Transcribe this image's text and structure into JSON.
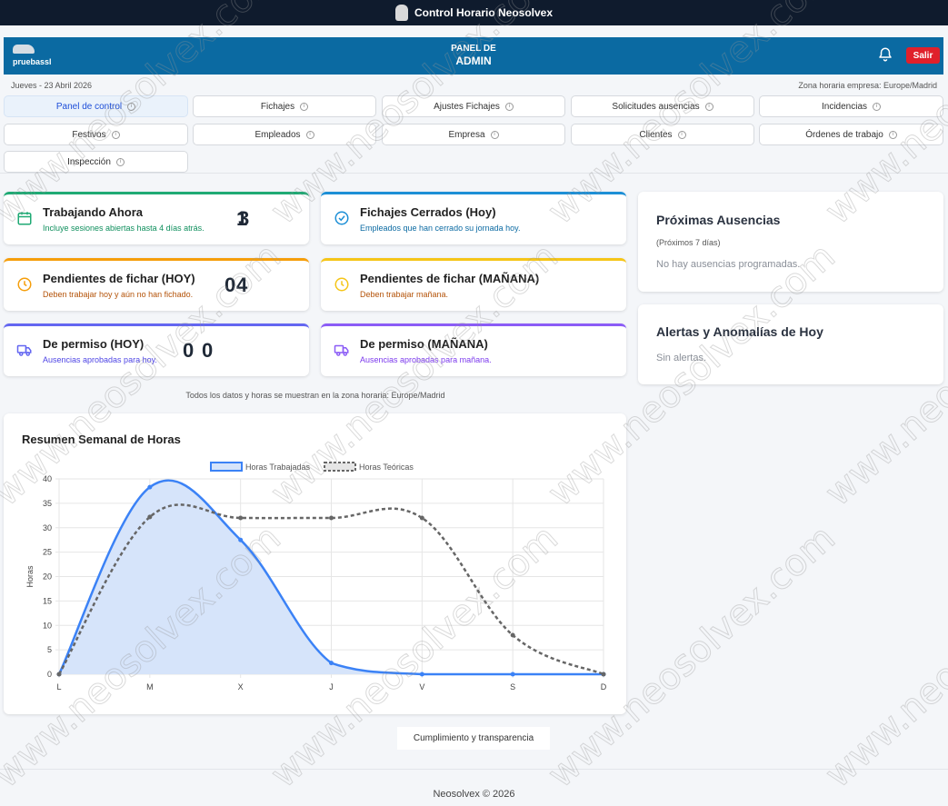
{
  "app": {
    "title": "Control Horario Neosolvex"
  },
  "header": {
    "username": "pruebassl",
    "panel_line1": "PANEL DE",
    "panel_line2": "ADMIN",
    "logout_label": "Salir"
  },
  "date": "Jueves - 23 Abril 2026",
  "timezone": "Zona horaria empresa: Europe/Madrid",
  "nav": [
    "Panel de control",
    "Fichajes",
    "Ajustes Fichajes",
    "Solicitudes ausencias",
    "Incidencias",
    "Festivos",
    "Empleados",
    "Empresa",
    "Clientes",
    "Órdenes de trabajo",
    "Inspección"
  ],
  "stats": [
    {
      "title": "Trabajando Ahora",
      "subtitle": "Incluye sesiones abiertas hasta 4 días atrás.",
      "value": "3",
      "color": "#1faa74"
    },
    {
      "title": "Fichajes Cerrados (Hoy)",
      "subtitle": "Empleados que han cerrado su jornada hoy.",
      "value": "1",
      "color": "#1d8fd6"
    },
    {
      "title": "Pendientes de fichar (HOY)",
      "subtitle": "Deben trabajar hoy y aún no han fichado.",
      "value": "0",
      "color": "#f59e0b"
    },
    {
      "title": "Pendientes de fichar (MAÑANA)",
      "subtitle": "Deben trabajar mañana.",
      "value": "4",
      "color": "#f5c518"
    },
    {
      "title": "De permiso (HOY)",
      "subtitle": "Ausencias aprobadas para hoy.",
      "value": "0",
      "color": "#6366f1"
    },
    {
      "title": "De permiso (MAÑANA)",
      "subtitle": "Ausencias aprobadas para mañana.",
      "value": "0",
      "color": "#8b5cf6"
    }
  ],
  "absences": {
    "title": "Próximas Ausencias",
    "range": "(Próximos 7 días)",
    "empty": "No hay ausencias programadas."
  },
  "alerts": {
    "title": "Alertas y Anomalías de Hoy",
    "empty": "Sin alertas."
  },
  "tz_note": "Todos los datos y horas se muestran en la zona horaria: Europe/Madrid",
  "chart_data": {
    "type": "line",
    "title": "Resumen Semanal de Horas",
    "xlabel": "",
    "ylabel": "Horas",
    "categories": [
      "L",
      "M",
      "X",
      "J",
      "V",
      "S",
      "D"
    ],
    "ylim": [
      0,
      40
    ],
    "yticks": [
      0,
      5,
      10,
      15,
      20,
      25,
      30,
      35,
      40
    ],
    "grid": true,
    "legend": "top-center",
    "series": [
      {
        "name": "Horas Trabajadas",
        "values": [
          0,
          38.3,
          27.5,
          2.3,
          0,
          0,
          0
        ],
        "color": "#3b82f6",
        "fill": "#d6e4fa",
        "style": "solid"
      },
      {
        "name": "Horas Teóricas",
        "values": [
          0,
          32.2,
          32,
          32,
          32,
          8,
          0
        ],
        "color": "#666666",
        "style": "dashed"
      }
    ]
  },
  "footer": {
    "link": "Cumplimiento y transparencia",
    "copyright": "Neosolvex © 2026"
  },
  "watermark": "www.neosolvex.com"
}
